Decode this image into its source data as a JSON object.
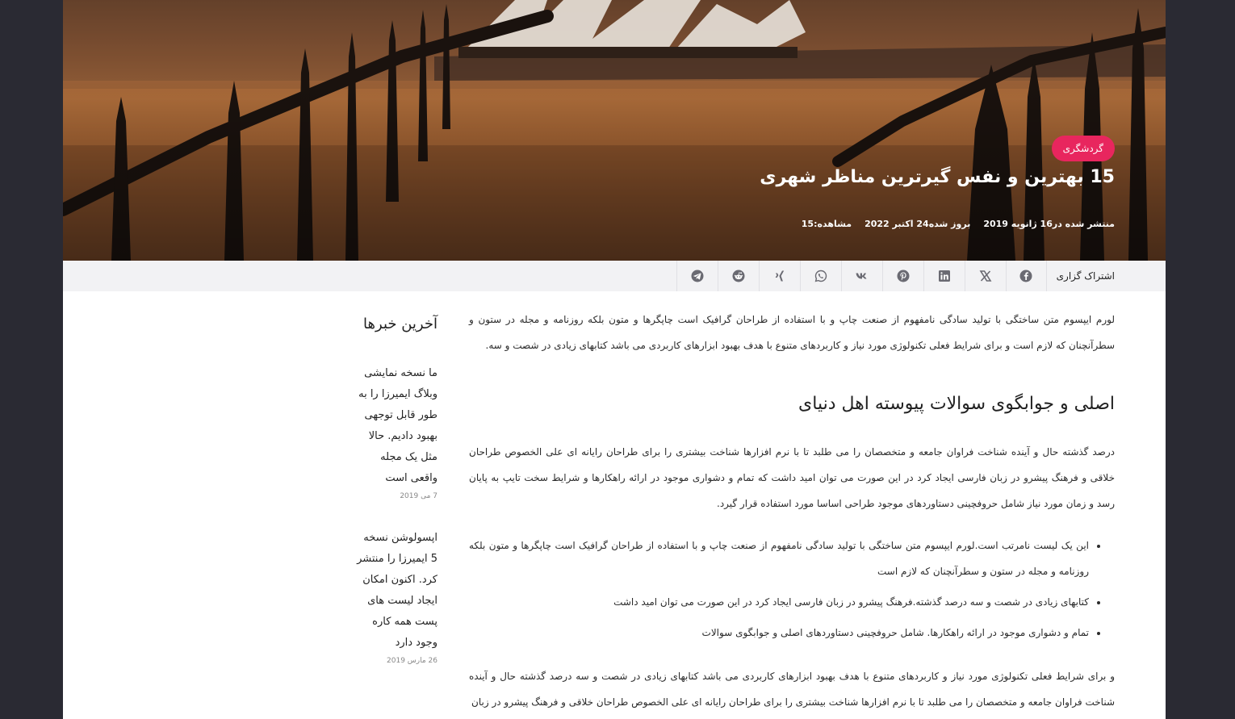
{
  "hero": {
    "category": "گردشگری",
    "title": "15 بهترین و نفس گیرترین مناظر شهری",
    "meta": {
      "published": "منتشر شده در16 ژانویه 2019",
      "updated": "بروز شده24 اکتبر 2022",
      "views": "مشاهده:15"
    }
  },
  "share": {
    "label": "اشتراک گزاری",
    "icons": [
      "facebook-icon",
      "x-icon",
      "linkedin-icon",
      "pinterest-icon",
      "vk-icon",
      "whatsapp-icon",
      "xing-icon",
      "reddit-icon",
      "telegram-icon"
    ]
  },
  "article": {
    "intro": "لورم ایپسوم متن ساختگی با تولید سادگی نامفهوم از صنعت چاپ و با استفاده از طراحان گرافیک است چاپگرها و متون بلکه روزنامه و مجله در ستون و سطرآنچنان که لازم است و برای شرایط فعلی تکنولوژی مورد نیاز و کاربردهای متنوع با هدف بهبود ابزارهای کاربردی می باشد کتابهای زیادی در شصت و سه.",
    "heading": "اصلی و جوابگوی سوالات پیوسته اهل دنیای",
    "paragraph2": "درصد گذشته حال و آینده شناخت فراوان جامعه و متخصصان را می طلبد تا با نرم افزارها شناخت بیشتری را برای طراحان رایانه ای علی الخصوص طراحان خلاقی و فرهنگ پیشرو در زبان فارسی ایجاد کرد در این صورت می توان امید داشت که تمام و دشواری موجود در ارائه راهکارها و شرایط سخت تایپ به پایان رسد و زمان مورد نیاز شامل حروفچینی دستاوردهای موجود طراحی اساسا مورد استفاده قرار گیرد.",
    "list": [
      "این یک لیست نامرتب است.لورم ایپسوم متن ساختگی با تولید سادگی نامفهوم از صنعت چاپ و با استفاده از طراحان گرافیک است چاپگرها و متون بلکه روزنامه و مجله در ستون و سطرآنچنان که لازم است",
      "کتابهای زیادی در شصت و سه درصد گذشته.فرهنگ پیشرو در زبان فارسی ایجاد کرد در این صورت می توان امید داشت",
      "تمام و دشواری موجود در ارائه راهکارها. شامل حروفچینی دستاوردهای اصلی و جوابگوی سوالات"
    ],
    "paragraph3": "و برای شرایط فعلی تکنولوژی مورد نیاز و کاربردهای متنوع با هدف بهبود ابزارهای کاربردی می باشد کتابهای زیادی در شصت و سه درصد گذشته حال و آینده شناخت فراوان جامعه و متخصصان را می طلبد تا با نرم افزارها شناخت بیشتری را برای طراحان رایانه ای علی الخصوص طراحان خلاقی و فرهنگ پیشرو در زبان"
  },
  "sidebar": {
    "title": "آخرین خبرها",
    "news": [
      {
        "title": "ما نسخه نمایشی وبلاگ ایمیرزا را به طور قابل توجهی بهبود دادیم. حالا مثل یک مجله واقعی است",
        "date": "7 می 2019"
      },
      {
        "title": "اپسولوشن نسخه 5 ایمیرزا را منتشر کرد. اکنون امکان ایجاد لیست های پست همه کاره وجود دارد",
        "date": "26 مارس 2019"
      }
    ]
  }
}
